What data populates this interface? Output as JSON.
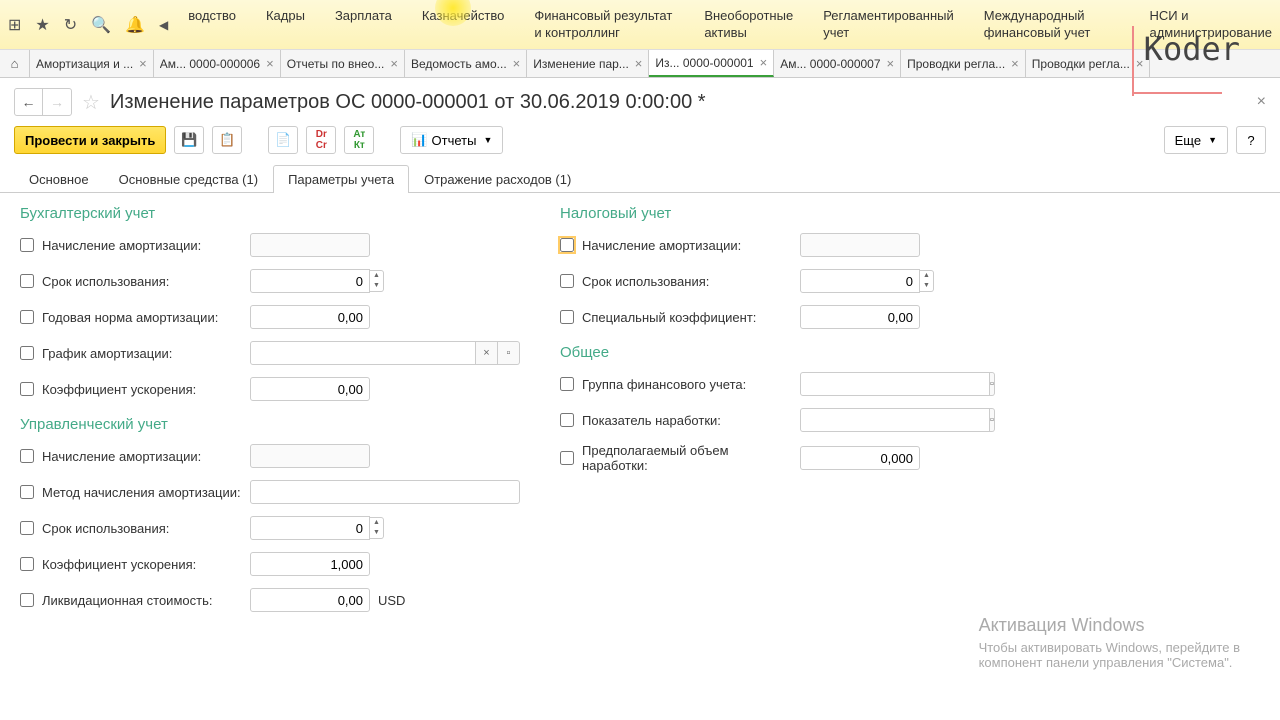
{
  "top_menu": {
    "items": [
      "водство",
      "Кадры",
      "Зарплата",
      "Казначейство",
      "Финансовый результат и контроллинг",
      "Внеоборотные активы",
      "Регламентированный учет",
      "Международный финансовый учет",
      "НСИ и администрирование"
    ]
  },
  "tabs": [
    {
      "label": "Амортизация и ...",
      "active": false
    },
    {
      "label": "Ам... 0000-000006",
      "active": false
    },
    {
      "label": "Отчеты по внео...",
      "active": false
    },
    {
      "label": "Ведомость амо...",
      "active": false
    },
    {
      "label": "Изменение пар...",
      "active": false
    },
    {
      "label": "Из... 0000-000001",
      "active": true
    },
    {
      "label": "Ам... 0000-000007",
      "active": false
    },
    {
      "label": "Проводки регла...",
      "active": false
    },
    {
      "label": "Проводки регла...",
      "active": false
    }
  ],
  "title": "Изменение параметров ОС 0000-000001 от 30.06.2019 0:00:00 *",
  "toolbar": {
    "post_close": "Провести и закрыть",
    "reports": "Отчеты",
    "more": "Еще"
  },
  "subtabs": [
    {
      "label": "Основное",
      "active": false
    },
    {
      "label": "Основные средства (1)",
      "active": false
    },
    {
      "label": "Параметры учета",
      "active": true
    },
    {
      "label": "Отражение расходов (1)",
      "active": false
    }
  ],
  "sections": {
    "accounting": {
      "title": "Бухгалтерский учет",
      "depr_charge": "Начисление амортизации:",
      "use_period": "Срок использования:",
      "use_period_val": "0",
      "annual_rate": "Годовая норма амортизации:",
      "annual_rate_val": "0,00",
      "schedule": "График амортизации:",
      "accel": "Коэффициент ускорения:",
      "accel_val": "0,00"
    },
    "management": {
      "title": "Управленческий учет",
      "depr_charge": "Начисление амортизации:",
      "method": "Метод начисления амортизации:",
      "use_period": "Срок использования:",
      "use_period_val": "0",
      "accel": "Коэффициент ускорения:",
      "accel_val": "1,000",
      "salvage": "Ликвидационная стоимость:",
      "salvage_val": "0,00",
      "currency": "USD"
    },
    "tax": {
      "title": "Налоговый учет",
      "depr_charge": "Начисление амортизации:",
      "use_period": "Срок использования:",
      "use_period_val": "0",
      "special": "Специальный коэффициент:",
      "special_val": "0,00"
    },
    "general": {
      "title": "Общее",
      "fin_group": "Группа финансового учета:",
      "output": "Показатель наработки:",
      "expected": "Предполагаемый объем наработки:",
      "expected_val": "0,000"
    }
  },
  "watermark": {
    "t1": "Активация Windows",
    "t2": "Чтобы активировать Windows, перейдите в",
    "t3": "компонент панели управления \"Система\"."
  },
  "logo": "Koder"
}
